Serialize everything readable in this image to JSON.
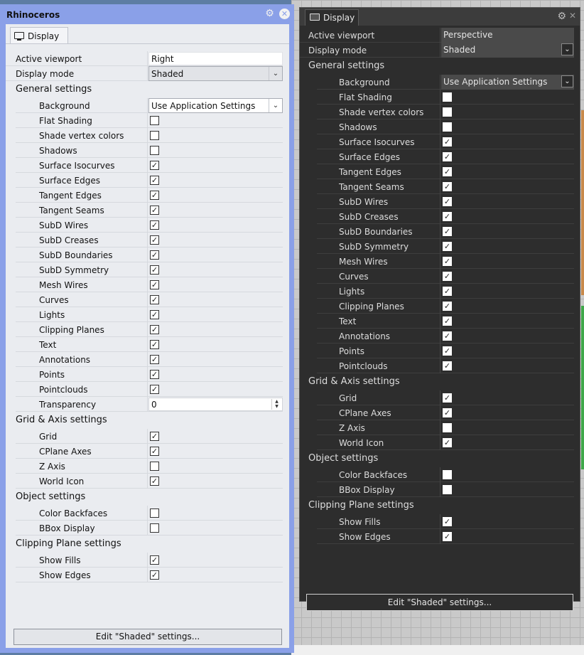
{
  "light": {
    "window_title": "Rhinoceros",
    "tab_label": "Display",
    "active_viewport_label": "Active viewport",
    "active_viewport_value": "Right",
    "display_mode_label": "Display mode",
    "display_mode_value": "Shaded",
    "general_header": "General settings",
    "background_label": "Background",
    "background_value": "Use Application Settings",
    "general_items": [
      {
        "label": "Flat Shading",
        "checked": false
      },
      {
        "label": "Shade vertex colors",
        "checked": false
      },
      {
        "label": "Shadows",
        "checked": false
      },
      {
        "label": "Surface Isocurves",
        "checked": true
      },
      {
        "label": "Surface Edges",
        "checked": true
      },
      {
        "label": "Tangent Edges",
        "checked": true
      },
      {
        "label": "Tangent Seams",
        "checked": true
      },
      {
        "label": "SubD Wires",
        "checked": true
      },
      {
        "label": "SubD Creases",
        "checked": true
      },
      {
        "label": "SubD Boundaries",
        "checked": true
      },
      {
        "label": "SubD Symmetry",
        "checked": true
      },
      {
        "label": "Mesh Wires",
        "checked": true
      },
      {
        "label": "Curves",
        "checked": true
      },
      {
        "label": "Lights",
        "checked": true
      },
      {
        "label": "Clipping Planes",
        "checked": true
      },
      {
        "label": "Text",
        "checked": true
      },
      {
        "label": "Annotations",
        "checked": true
      },
      {
        "label": "Points",
        "checked": true
      },
      {
        "label": "Pointclouds",
        "checked": true
      }
    ],
    "transparency_label": "Transparency",
    "transparency_value": "0",
    "grid_header": "Grid & Axis settings",
    "grid_items": [
      {
        "label": "Grid",
        "checked": true
      },
      {
        "label": "CPlane Axes",
        "checked": true
      },
      {
        "label": "Z Axis",
        "checked": false
      },
      {
        "label": "World Icon",
        "checked": true
      }
    ],
    "object_header": "Object settings",
    "object_items": [
      {
        "label": "Color Backfaces",
        "checked": false
      },
      {
        "label": "BBox Display",
        "checked": false
      }
    ],
    "clipping_header": "Clipping Plane settings",
    "clipping_items": [
      {
        "label": "Show Fills",
        "checked": true
      },
      {
        "label": "Show Edges",
        "checked": true
      }
    ],
    "edit_button": "Edit \"Shaded\" settings..."
  },
  "dark": {
    "tab_label": "Display",
    "active_viewport_label": "Active viewport",
    "active_viewport_value": "Perspective",
    "display_mode_label": "Display mode",
    "display_mode_value": "Shaded",
    "general_header": "General settings",
    "background_label": "Background",
    "background_value": "Use Application Settings",
    "general_items": [
      {
        "label": "Flat Shading",
        "checked": false
      },
      {
        "label": "Shade vertex colors",
        "checked": false
      },
      {
        "label": "Shadows",
        "checked": false
      },
      {
        "label": "Surface Isocurves",
        "checked": true
      },
      {
        "label": "Surface Edges",
        "checked": true
      },
      {
        "label": "Tangent Edges",
        "checked": true
      },
      {
        "label": "Tangent Seams",
        "checked": true
      },
      {
        "label": "SubD Wires",
        "checked": true
      },
      {
        "label": "SubD Creases",
        "checked": true
      },
      {
        "label": "SubD Boundaries",
        "checked": true
      },
      {
        "label": "SubD Symmetry",
        "checked": true
      },
      {
        "label": "Mesh Wires",
        "checked": true
      },
      {
        "label": "Curves",
        "checked": true
      },
      {
        "label": "Lights",
        "checked": true
      },
      {
        "label": "Clipping Planes",
        "checked": true
      },
      {
        "label": "Text",
        "checked": true
      },
      {
        "label": "Annotations",
        "checked": true
      },
      {
        "label": "Points",
        "checked": true
      },
      {
        "label": "Pointclouds",
        "checked": true
      }
    ],
    "grid_header": "Grid & Axis settings",
    "grid_items": [
      {
        "label": "Grid",
        "checked": true
      },
      {
        "label": "CPlane Axes",
        "checked": true
      },
      {
        "label": "Z Axis",
        "checked": false
      },
      {
        "label": "World Icon",
        "checked": true
      }
    ],
    "object_header": "Object settings",
    "object_items": [
      {
        "label": "Color Backfaces",
        "checked": false
      },
      {
        "label": "BBox Display",
        "checked": false
      }
    ],
    "clipping_header": "Clipping Plane settings",
    "clipping_items": [
      {
        "label": "Show Fills",
        "checked": true
      },
      {
        "label": "Show Edges",
        "checked": true
      }
    ],
    "edit_button": "Edit \"Shaded\" settings..."
  },
  "icons": {
    "gear": "gear-icon",
    "close": "close-icon",
    "monitor": "monitor-icon",
    "check": "✓",
    "dropdown": "chevron-down-icon"
  }
}
